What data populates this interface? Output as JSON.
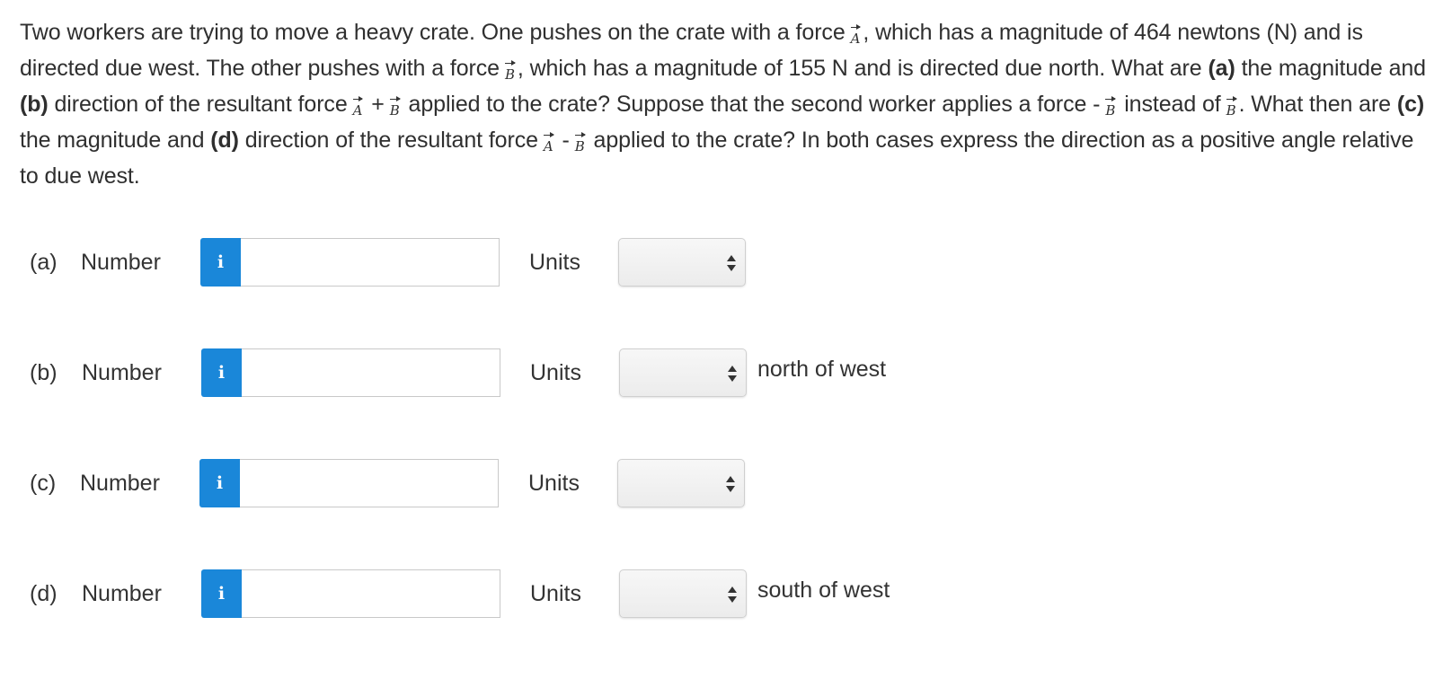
{
  "question": {
    "s1": "Two workers are trying to move a heavy crate. One pushes on the crate with a force",
    "vecA": "A",
    "s2": ", which has a magnitude of 464 newtons (N) and is directed due west. The other pushes with a force",
    "vecB": "B",
    "s3": ", which has a magnitude of 155 N and is directed due north. What are",
    "bold_a": "(a)",
    "s4": "the magnitude and",
    "bold_b": "(b)",
    "s5": "direction of the resultant force",
    "plus": "+",
    "s6": "applied to the crate? Suppose that the second worker applies a force -",
    "s7": "instead of",
    "s8": ". What then are",
    "bold_c": "(c)",
    "s9": "the magnitude and",
    "bold_d": "(d)",
    "s10": "direction of the resultant force",
    "minus": "-",
    "s11": "applied to the crate? In both cases express the direction as a positive angle relative to due west."
  },
  "rows": [
    {
      "part": "(a)",
      "number_label": "Number",
      "info_icon": "i",
      "value": "",
      "units_label": "Units",
      "units_value": "",
      "suffix": ""
    },
    {
      "part": "(b)",
      "number_label": "Number",
      "info_icon": "i",
      "value": "",
      "units_label": "Units",
      "units_value": "",
      "suffix": "north of west"
    },
    {
      "part": "(c)",
      "number_label": "Number",
      "info_icon": "i",
      "value": "",
      "units_label": "Units",
      "units_value": "",
      "suffix": ""
    },
    {
      "part": "(d)",
      "number_label": "Number",
      "info_icon": "i",
      "value": "",
      "units_label": "Units",
      "units_value": "",
      "suffix": "south of west"
    }
  ],
  "colors": {
    "info_button": "#1a87d9",
    "text": "#2f2f2f"
  }
}
